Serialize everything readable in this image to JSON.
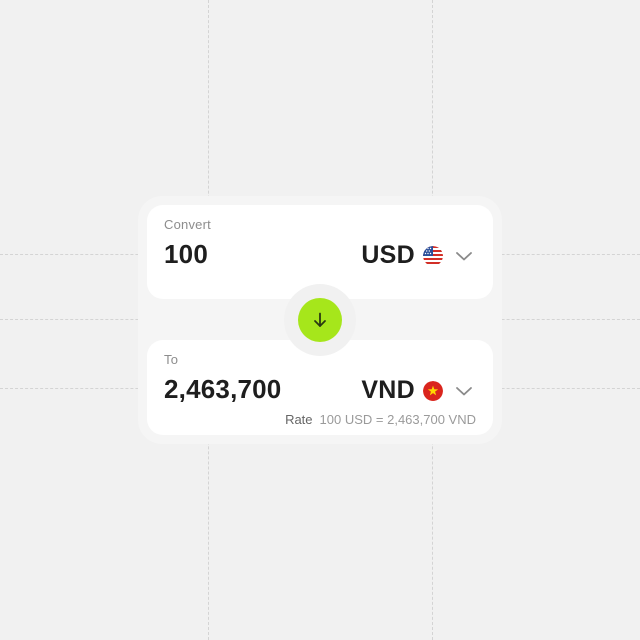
{
  "converter": {
    "from": {
      "label": "Convert",
      "amount": "100",
      "currency": "USD",
      "flag_icon": "us-flag-icon"
    },
    "to": {
      "label": "To",
      "amount": "2,463,700",
      "currency": "VND",
      "flag_icon": "vn-flag-icon",
      "rate_label": "Rate",
      "rate_value": "100 USD = 2,463,700 VND"
    },
    "swap_icon": "arrow-down-icon"
  },
  "colors": {
    "background": "#f1f1f1",
    "card": "#ffffff",
    "accent": "#a6e61b",
    "text_primary": "#1e1e1e",
    "text_secondary": "#8d8d8d"
  }
}
